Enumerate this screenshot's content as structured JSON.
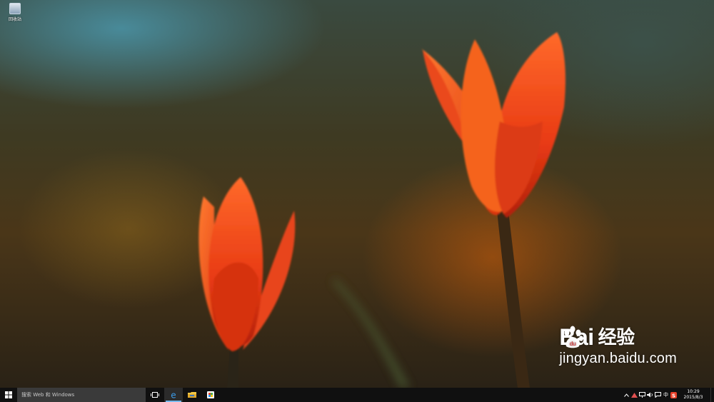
{
  "desktop": {
    "icons": [
      {
        "label": "回收站",
        "icon": "recycle-bin-icon"
      }
    ]
  },
  "watermark": {
    "brand_left": "Bai",
    "brand_right": "经验",
    "url": "jingyan.baidu.com"
  },
  "taskbar": {
    "search_placeholder": "搜索 Web 和 Windows",
    "apps": [
      {
        "name": "task-view",
        "icon": "task-view-icon"
      },
      {
        "name": "edge",
        "icon": "edge-icon",
        "active": true
      },
      {
        "name": "file-explorer",
        "icon": "folder-icon"
      },
      {
        "name": "store",
        "icon": "store-icon"
      }
    ],
    "tray": {
      "ime": "中",
      "time": "10:29",
      "date": "2015/8/3"
    }
  },
  "colors": {
    "taskbar_bg": "#101010",
    "accent": "#76b9ed",
    "tulip": "#f04018"
  }
}
